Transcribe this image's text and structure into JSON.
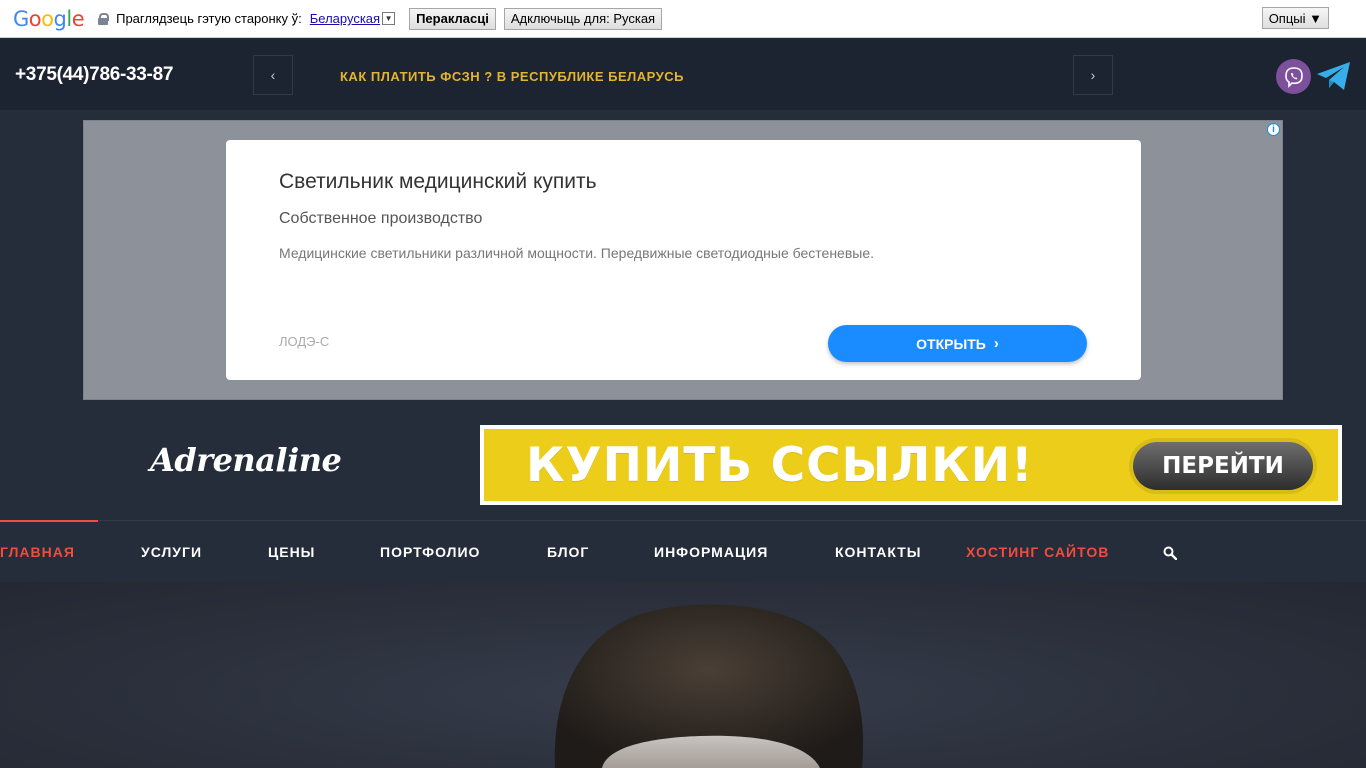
{
  "translate_bar": {
    "logo": "Google",
    "prompt": "Праглядзець гэтую старонку ў:",
    "language": "Беларуская",
    "language_arrow": "▼",
    "translate_label": "Перакласці",
    "disable_label": "Адключыць для: Руская",
    "options_label": "Опцыі ▼"
  },
  "topbar": {
    "phone": "+375(44)786-33-87",
    "prev_icon": "‹",
    "next_icon": "›",
    "ticker": "КАК ПЛАТИТЬ ФСЗН ? В РЕСПУБЛИКЕ БЕЛАРУСЬ",
    "icons": [
      "viber-icon",
      "telegram-icon"
    ]
  },
  "ad": {
    "info_icon": "i",
    "title": "Светильник медицинский купить",
    "subtitle": "Собственное производство",
    "description": "Медицинские светильники различной мощности. Передвижные светодиодные бестеневые.",
    "brand": "ЛОДЭ-С",
    "button_label": "ОТКРЫТЬ",
    "button_icon": "›"
  },
  "header": {
    "logo": "Adrenaline",
    "banner_text": "КУПИТЬ ССЫЛКИ!",
    "banner_button": "ПЕРЕЙТИ"
  },
  "nav": {
    "items": [
      "ГЛАВНАЯ",
      "УСЛУГИ",
      "ЦЕНЫ",
      "ПОРТФОЛИО",
      "БЛОГ",
      "ИНФОРМАЦИЯ",
      "КОНТАКТЫ",
      "ХОСТИНГ САЙТОВ"
    ],
    "active_color": "#ef4d3d"
  }
}
